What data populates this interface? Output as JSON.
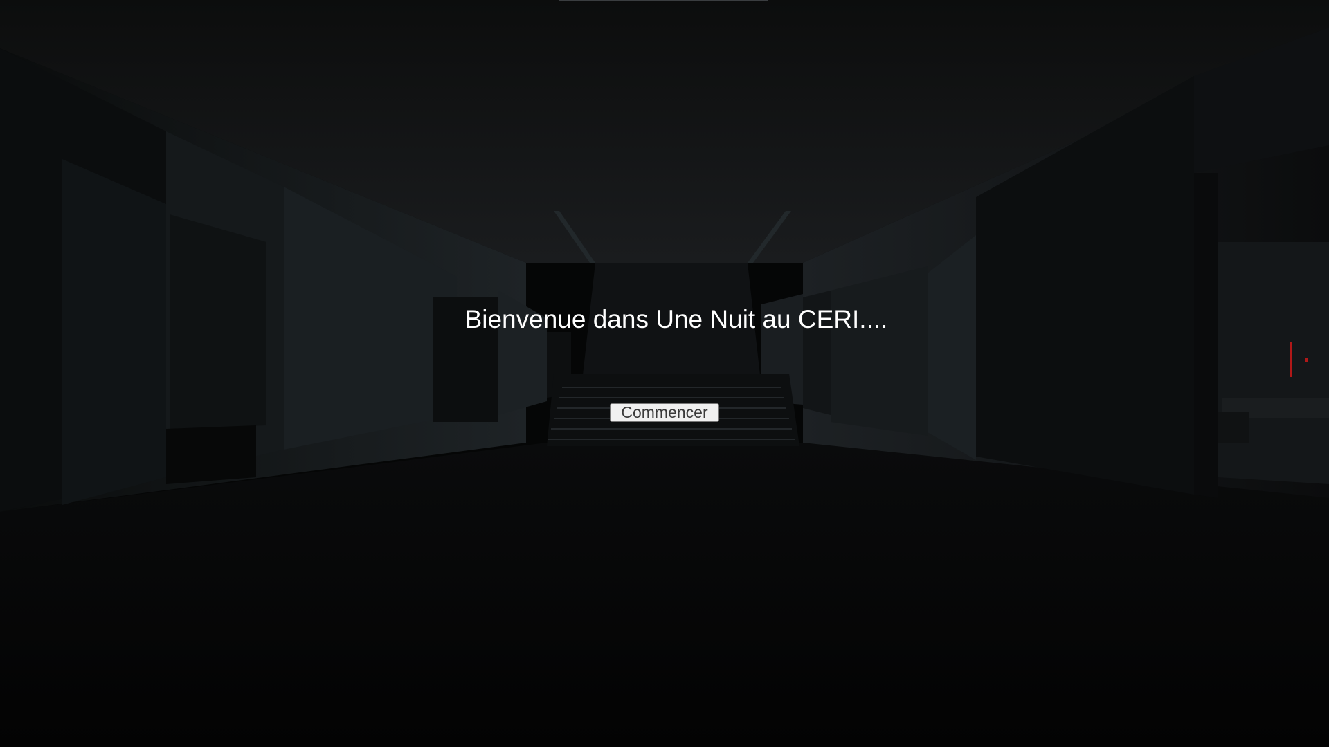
{
  "menu": {
    "title": "Bienvenue dans Une Nuit au CERI....",
    "start_label": "Commencer"
  },
  "scene": {
    "description_icon": "dark-corridor-staircase",
    "ceiling_color": "#0e0f0f",
    "wall_color": "#151819",
    "floor_color": "#030404",
    "accent_red": "#b01818"
  }
}
